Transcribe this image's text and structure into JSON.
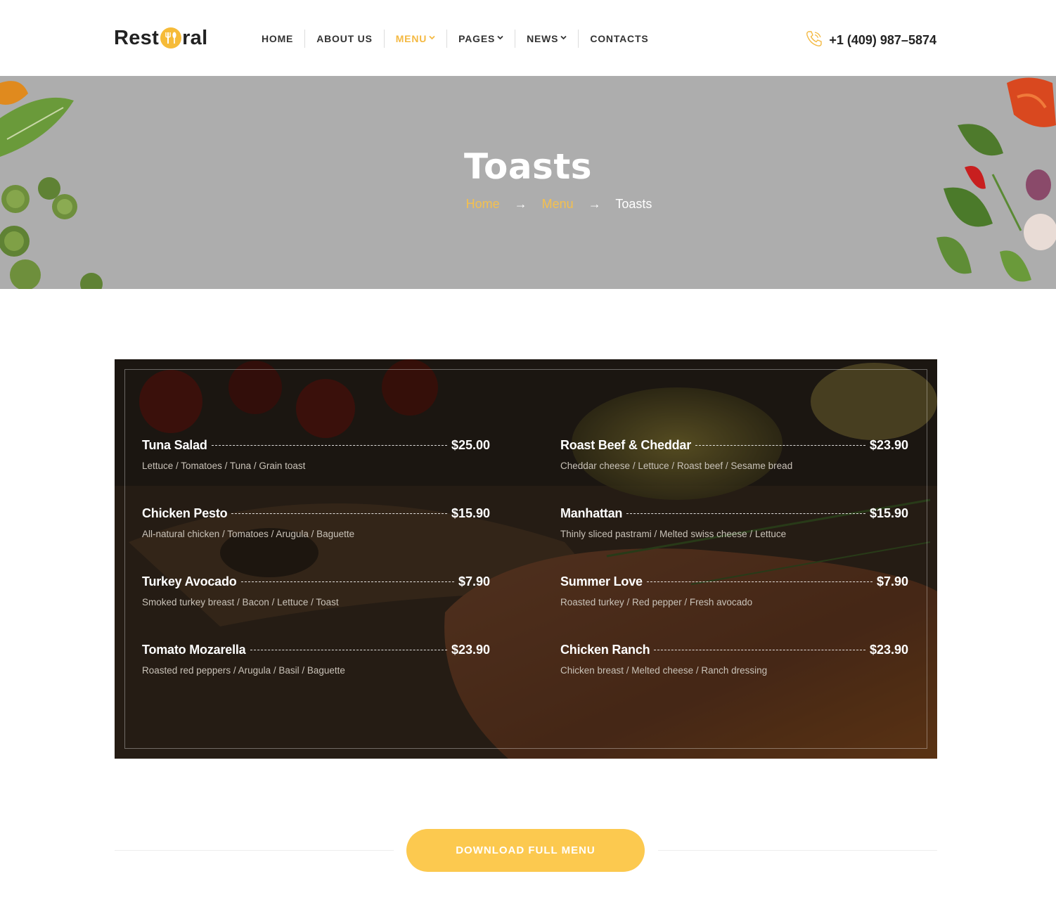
{
  "brand": {
    "name_left": "Rest",
    "name_right": "ral",
    "accent": "#f6bb38"
  },
  "nav": {
    "items": [
      {
        "label": "HOME",
        "has_dropdown": false,
        "active": false
      },
      {
        "label": "ABOUT US",
        "has_dropdown": false,
        "active": false
      },
      {
        "label": "MENU",
        "has_dropdown": true,
        "active": true
      },
      {
        "label": "PAGES",
        "has_dropdown": true,
        "active": false
      },
      {
        "label": "NEWS",
        "has_dropdown": true,
        "active": false
      },
      {
        "label": "CONTACTS",
        "has_dropdown": false,
        "active": false
      }
    ],
    "active_color": "#f4b942"
  },
  "header": {
    "phone": "+1 (409) 987–5874",
    "phone_icon": "phone-icon"
  },
  "hero": {
    "title": "Toasts",
    "breadcrumb": {
      "home": "Home",
      "menu": "Menu",
      "current": "Toasts",
      "separator": "→"
    }
  },
  "menu": {
    "left": [
      {
        "name": "Tuna Salad",
        "price": "$25.00",
        "desc": "Lettuce / Tomatoes / Tuna / Grain toast"
      },
      {
        "name": "Chicken Pesto",
        "price": "$15.90",
        "desc": "All-natural chicken / Tomatoes / Arugula / Baguette"
      },
      {
        "name": "Turkey Avocado",
        "price": "$7.90",
        "desc": "Smoked turkey breast / Bacon / Lettuce / Toast"
      },
      {
        "name": "Tomato Mozarella",
        "price": "$23.90",
        "desc": "Roasted red peppers / Arugula / Basil / Baguette"
      }
    ],
    "right": [
      {
        "name": "Roast Beef & Cheddar",
        "price": "$23.90",
        "desc": "Cheddar cheese / Lettuce / Roast beef / Sesame bread"
      },
      {
        "name": "Manhattan",
        "price": "$15.90",
        "desc": "Thinly sliced pastrami / Melted swiss cheese / Lettuce"
      },
      {
        "name": "Summer Love",
        "price": "$7.90",
        "desc": "Roasted turkey / Red pepper / Fresh avocado"
      },
      {
        "name": "Chicken Ranch",
        "price": "$23.90",
        "desc": "Chicken breast / Melted cheese / Ranch dressing"
      }
    ]
  },
  "download": {
    "label": "DOWNLOAD FULL MENU",
    "color": "#fcc94f"
  }
}
